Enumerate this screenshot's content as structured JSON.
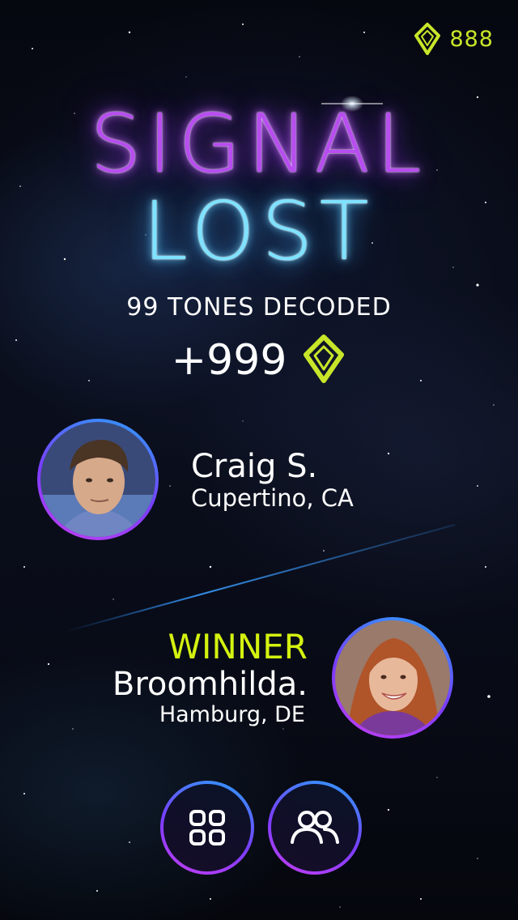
{
  "currency": {
    "value": "888",
    "icon": "gem-icon",
    "color": "#c8e629"
  },
  "title": {
    "line1": "SIGNAL",
    "line2": "LOST"
  },
  "result": {
    "tones_text": "99 TONES DECODED",
    "reward": "+999",
    "reward_icon": "gem-icon"
  },
  "players": [
    {
      "name": "Craig S.",
      "location": "Cupertino, CA"
    },
    {
      "label": "WINNER",
      "name": "Broomhilda.",
      "location": "Hamburg, DE"
    }
  ],
  "buttons": {
    "menu_icon": "grid-icon",
    "friends_icon": "friends-icon"
  },
  "colors": {
    "accent_lime": "#d4f20f",
    "title_magenta": "#b84df0",
    "title_cyan": "#7fe2ff",
    "ring_blue": "#2aa0ff",
    "ring_purple": "#c43ef0"
  }
}
